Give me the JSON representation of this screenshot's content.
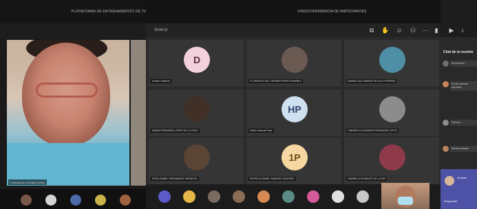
{
  "left_window": {
    "title": "PLATAFORMA DE ENTRENAMIENTO DE TIC",
    "main_participant_name": "Participante principal (video)",
    "bottom_avatars": [
      "#7a5848",
      "#d4d4d4",
      "#4d6aa8",
      "#c9b24a",
      "#a0623e"
    ]
  },
  "main_window": {
    "title": "VIDEOCONFERENCIA DE PARTICIPANTES",
    "timer": "25:04:13",
    "tiles": [
      {
        "initials": "D",
        "avatar_bg": "#f3d1dc",
        "avatar_fg": "#5a2b3a",
        "name": "Denise Gallardo"
      },
      {
        "initials": "",
        "avatar_bg": "#6b5a52",
        "avatar_fg": "#fff",
        "name": "FLORENCIA DEL CARMEN PEREZ RAMIREZ"
      },
      {
        "initials": "",
        "avatar_bg": "#4f8fa6",
        "avatar_fg": "#fff",
        "name": "DANIELA ALEJANDRA SILVA GUTIERREZ"
      },
      {
        "initials": "",
        "avatar_bg": "#403028",
        "avatar_fg": "#fff",
        "name": "MARIA FERNANDA LOPEZ DE LA CRUZ"
      },
      {
        "initials": "HP",
        "avatar_bg": "#cfe0f0",
        "avatar_fg": "#2b3f6b",
        "name": "Hector Manuel Paez"
      },
      {
        "initials": "",
        "avatar_bg": "#8c8c8c",
        "avatar_fg": "#fff",
        "name": "CARMEN ALEJANDRA FERNANDEZ ORTIZ"
      },
      {
        "initials": "",
        "avatar_bg": "#5a4434",
        "avatar_fg": "#fff",
        "name": "ROSA ISABEL HERNANDEZ MENDOZA"
      },
      {
        "initials": "1P",
        "avatar_bg": "#f6d7a1",
        "avatar_fg": "#6b4a14",
        "name": "PATRICIA ISABEL RAMIREZ SANCHEZ"
      },
      {
        "initials": "",
        "avatar_bg": "#8e3a4a",
        "avatar_fg": "#fff",
        "name": "GABRIELA MORALES DE LA PAZ"
      }
    ],
    "bottom_avatars": [
      "#5a5ac8",
      "#e6b84a",
      "#7b6a60",
      "#8a6c55",
      "#d58a54",
      "#5b8b86",
      "#d65a9a",
      "#e0e0e0",
      "#c8c8c8"
    ],
    "toolbar_icons": [
      "share-icon",
      "raise-hand-icon",
      "reactions-icon",
      "people-icon",
      "more-icon",
      "camera-icon",
      "mic-icon"
    ]
  },
  "chat": {
    "title": "Chat de la reunión",
    "messages": [
      {
        "avatar": "#6e6e6e",
        "text": "Escucharon"
      },
      {
        "avatar": "#c9855a",
        "text": "Es que querían escuchar"
      },
      {
        "avatar": "#8a8a8a",
        "text": "Saludos"
      },
      {
        "avatar": "#b5835e",
        "text": "Muchas gracias"
      }
    ],
    "highlight_text": "Gracias",
    "highlight_footer": "Responder"
  }
}
